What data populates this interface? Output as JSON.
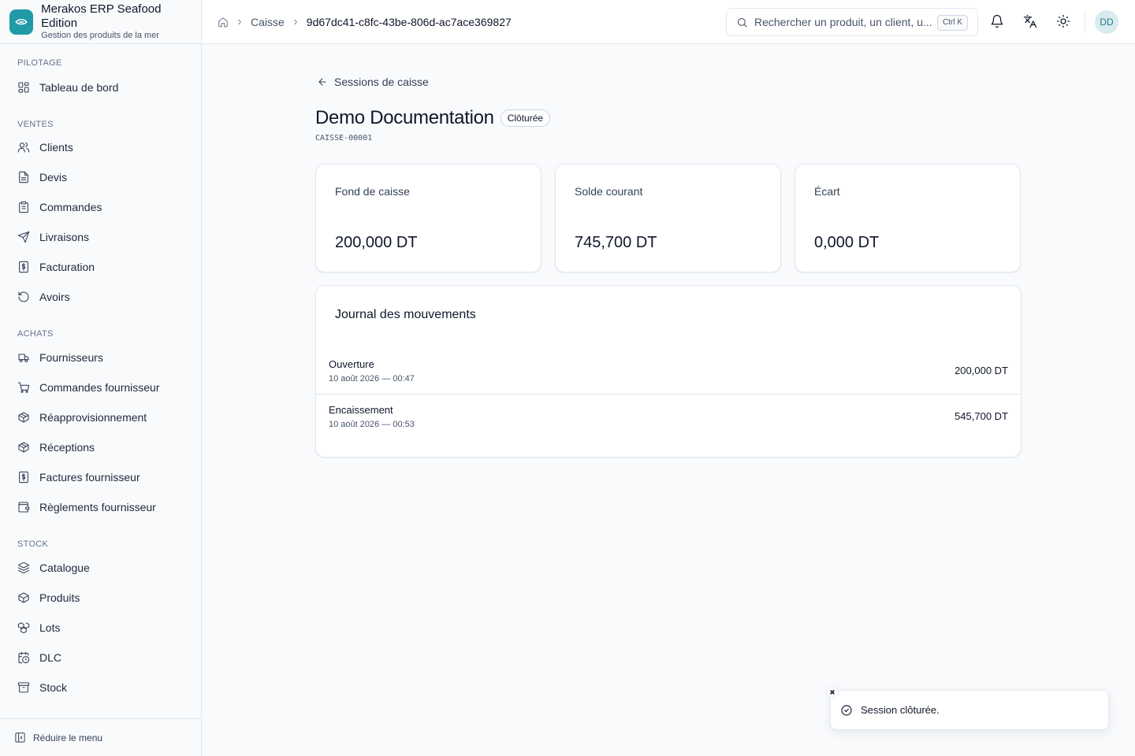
{
  "brand": {
    "name": "Merakos ERP Seafood Edition",
    "subtitle": "Gestion des produits de la mer",
    "accent_color": "#1f9aa6"
  },
  "sidebar": {
    "sections": [
      {
        "label": "PILOTAGE",
        "items": [
          {
            "label": "Tableau de bord",
            "icon": "layout-dashboard-icon"
          }
        ]
      },
      {
        "label": "VENTES",
        "items": [
          {
            "label": "Clients",
            "icon": "users-icon"
          },
          {
            "label": "Devis",
            "icon": "file-text-icon"
          },
          {
            "label": "Commandes",
            "icon": "clipboard-list-icon"
          },
          {
            "label": "Livraisons",
            "icon": "send-icon"
          },
          {
            "label": "Facturation",
            "icon": "receipt-dollar-icon"
          },
          {
            "label": "Avoirs",
            "icon": "rotate-ccw-icon"
          }
        ]
      },
      {
        "label": "ACHATS",
        "items": [
          {
            "label": "Fournisseurs",
            "icon": "truck-icon"
          },
          {
            "label": "Commandes fournisseur",
            "icon": "shopping-cart-icon"
          },
          {
            "label": "Réapprovisionnement",
            "icon": "package-plus-icon"
          },
          {
            "label": "Réceptions",
            "icon": "package-check-icon"
          },
          {
            "label": "Factures fournisseur",
            "icon": "receipt-dollar-icon"
          },
          {
            "label": "Règlements fournisseur",
            "icon": "wallet-icon"
          }
        ]
      },
      {
        "label": "STOCK",
        "items": [
          {
            "label": "Catalogue",
            "icon": "layers-icon"
          },
          {
            "label": "Produits",
            "icon": "package-icon"
          },
          {
            "label": "Lots",
            "icon": "boxes-icon"
          },
          {
            "label": "DLC",
            "icon": "calendar-clock-icon"
          },
          {
            "label": "Stock",
            "icon": "archive-icon"
          }
        ]
      }
    ],
    "collapse_label": "Réduire le menu"
  },
  "topbar": {
    "breadcrumb": [
      "Caisse",
      "9d67dc41-c8fc-43be-806d-ac7ace369827"
    ],
    "search_placeholder": "Rechercher un produit, un client, u...",
    "search_shortcut": "Ctrl K",
    "avatar_initials": "DD"
  },
  "session": {
    "back_label": "Sessions de caisse",
    "title": "Demo Documentation",
    "status": "Clôturée",
    "code": "CAISSE-00001",
    "stats": [
      {
        "label": "Fond de caisse",
        "value": "200,000 DT"
      },
      {
        "label": "Solde courant",
        "value": "745,700 DT"
      },
      {
        "label": "Écart",
        "value": "0,000 DT"
      }
    ],
    "journal": {
      "title": "Journal des mouvements",
      "rows": [
        {
          "type": "Ouverture",
          "date": "10 août 2026 — 00:47",
          "amount": "200,000 DT"
        },
        {
          "type": "Encaissement",
          "date": "10 août 2026 — 00:53",
          "amount": "545,700 DT"
        }
      ]
    }
  },
  "toast": {
    "message": "Session clôturée."
  }
}
